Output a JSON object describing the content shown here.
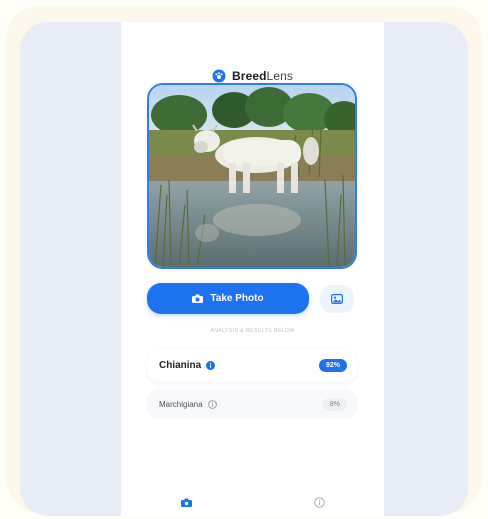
{
  "app": {
    "title_bold": "Breed",
    "title_light": "Lens",
    "logo_icon": "paw-globe-icon"
  },
  "photo": {
    "subject": "cow-standing-in-water"
  },
  "actions": {
    "take_photo_label": "Take Photo",
    "camera_icon": "camera-icon",
    "gallery_icon": "gallery-icon"
  },
  "hint": "ANALYSIS & RESULTS BELOW",
  "results": [
    {
      "name": "Chianina",
      "confidence": "92%",
      "info_icon": "info-icon"
    },
    {
      "name": "Marchigiana",
      "confidence": "8%",
      "info_icon": "info-icon"
    }
  ],
  "tabs": [
    {
      "id": "camera",
      "icon": "camera-icon"
    },
    {
      "id": "info",
      "icon": "info-icon"
    }
  ],
  "colors": {
    "accent": "#1d73ee",
    "backdrop": "#e7ecf7",
    "frame": "#fdf6ea"
  }
}
